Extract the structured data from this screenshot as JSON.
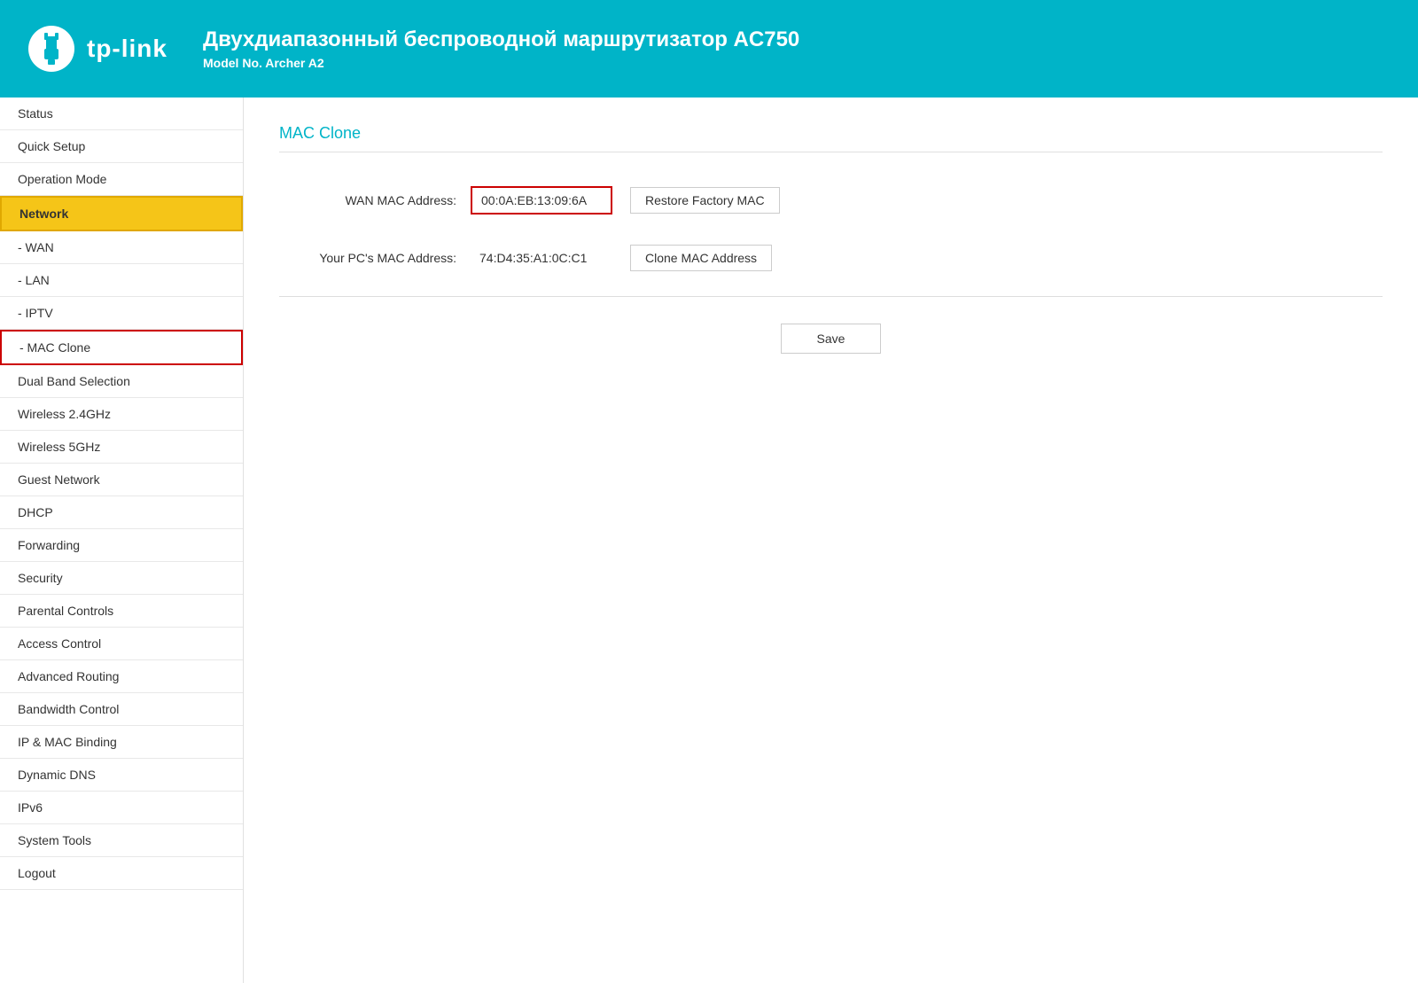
{
  "header": {
    "title": "Двухдиапазонный беспроводной маршрутизатор AC750",
    "subtitle": "Model No. Archer A2",
    "logo_text": "tp-link"
  },
  "sidebar": {
    "items": [
      {
        "id": "status",
        "label": "Status",
        "indent": false,
        "active": false,
        "mac_clone": false
      },
      {
        "id": "quick-setup",
        "label": "Quick Setup",
        "indent": false,
        "active": false,
        "mac_clone": false
      },
      {
        "id": "operation-mode",
        "label": "Operation Mode",
        "indent": false,
        "active": false,
        "mac_clone": false
      },
      {
        "id": "network",
        "label": "Network",
        "indent": false,
        "active": true,
        "mac_clone": false
      },
      {
        "id": "wan",
        "label": "- WAN",
        "indent": true,
        "active": false,
        "mac_clone": false
      },
      {
        "id": "lan",
        "label": "- LAN",
        "indent": true,
        "active": false,
        "mac_clone": false
      },
      {
        "id": "iptv",
        "label": "- IPTV",
        "indent": true,
        "active": false,
        "mac_clone": false
      },
      {
        "id": "mac-clone",
        "label": "- MAC Clone",
        "indent": true,
        "active": false,
        "mac_clone": true
      },
      {
        "id": "dual-band",
        "label": "Dual Band Selection",
        "indent": false,
        "active": false,
        "mac_clone": false
      },
      {
        "id": "wireless-24",
        "label": "Wireless 2.4GHz",
        "indent": false,
        "active": false,
        "mac_clone": false
      },
      {
        "id": "wireless-5",
        "label": "Wireless 5GHz",
        "indent": false,
        "active": false,
        "mac_clone": false
      },
      {
        "id": "guest-network",
        "label": "Guest Network",
        "indent": false,
        "active": false,
        "mac_clone": false
      },
      {
        "id": "dhcp",
        "label": "DHCP",
        "indent": false,
        "active": false,
        "mac_clone": false
      },
      {
        "id": "forwarding",
        "label": "Forwarding",
        "indent": false,
        "active": false,
        "mac_clone": false
      },
      {
        "id": "security",
        "label": "Security",
        "indent": false,
        "active": false,
        "mac_clone": false
      },
      {
        "id": "parental-controls",
        "label": "Parental Controls",
        "indent": false,
        "active": false,
        "mac_clone": false
      },
      {
        "id": "access-control",
        "label": "Access Control",
        "indent": false,
        "active": false,
        "mac_clone": false
      },
      {
        "id": "advanced-routing",
        "label": "Advanced Routing",
        "indent": false,
        "active": false,
        "mac_clone": false
      },
      {
        "id": "bandwidth-control",
        "label": "Bandwidth Control",
        "indent": false,
        "active": false,
        "mac_clone": false
      },
      {
        "id": "ip-mac-binding",
        "label": "IP & MAC Binding",
        "indent": false,
        "active": false,
        "mac_clone": false
      },
      {
        "id": "dynamic-dns",
        "label": "Dynamic DNS",
        "indent": false,
        "active": false,
        "mac_clone": false
      },
      {
        "id": "ipv6",
        "label": "IPv6",
        "indent": false,
        "active": false,
        "mac_clone": false
      },
      {
        "id": "system-tools",
        "label": "System Tools",
        "indent": false,
        "active": false,
        "mac_clone": false
      },
      {
        "id": "logout",
        "label": "Logout",
        "indent": false,
        "active": false,
        "mac_clone": false
      }
    ]
  },
  "content": {
    "page_title": "MAC Clone",
    "wan_mac_label": "WAN MAC Address:",
    "wan_mac_value": "00:0A:EB:13:09:6A",
    "pc_mac_label": "Your PC's MAC Address:",
    "pc_mac_value": "74:D4:35:A1:0C:C1",
    "restore_factory_label": "Restore Factory MAC",
    "clone_mac_label": "Clone MAC Address",
    "save_label": "Save"
  }
}
